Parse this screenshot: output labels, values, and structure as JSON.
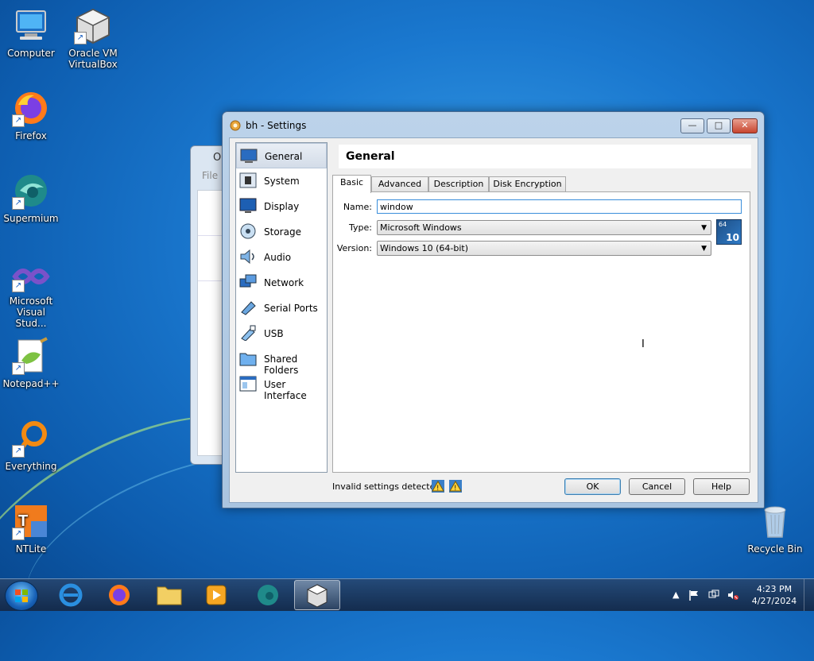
{
  "desktop": {
    "icons": [
      {
        "label": "Computer"
      },
      {
        "label": "Oracle VM VirtualBox"
      },
      {
        "label": "Firefox"
      },
      {
        "label": "Supermium"
      },
      {
        "label": "Microsoft Visual Stud..."
      },
      {
        "label": "Notepad++"
      },
      {
        "label": "Everything"
      },
      {
        "label": "NTLite"
      },
      {
        "label": "Recycle Bin"
      }
    ]
  },
  "bg_window": {
    "title_fragment": "O",
    "menu_fragment": "File"
  },
  "dialog": {
    "title": "bh - Settings",
    "window_buttons": {
      "minimize": "—",
      "maximize": "□",
      "close": "✕"
    },
    "sidebar": [
      {
        "label": "General",
        "selected": true
      },
      {
        "label": "System"
      },
      {
        "label": "Display"
      },
      {
        "label": "Storage"
      },
      {
        "label": "Audio"
      },
      {
        "label": "Network"
      },
      {
        "label": "Serial Ports"
      },
      {
        "label": "USB"
      },
      {
        "label": "Shared Folders"
      },
      {
        "label": "User Interface"
      }
    ],
    "section_title": "General",
    "tabs": [
      {
        "label": "Basic",
        "selected": true
      },
      {
        "label": "Advanced"
      },
      {
        "label": "Description"
      },
      {
        "label": "Disk Encryption"
      }
    ],
    "form": {
      "name_label": "Name:",
      "name_value": "window",
      "type_label": "Type:",
      "type_value": "Microsoft Windows",
      "version_label": "Version:",
      "version_value": "Windows 10 (64-bit)",
      "os_badge_top": "64",
      "os_badge_bottom": "10"
    },
    "status": "Invalid settings detected",
    "buttons": {
      "ok": "OK",
      "cancel": "Cancel",
      "help": "Help"
    }
  },
  "taskbar": {
    "clock_time": "4:23 PM",
    "clock_date": "4/27/2024",
    "tray_chevron": "▲",
    "pinned": [
      "start",
      "internet-explorer",
      "firefox",
      "file-explorer",
      "media-player",
      "supermium",
      "virtualbox"
    ]
  }
}
